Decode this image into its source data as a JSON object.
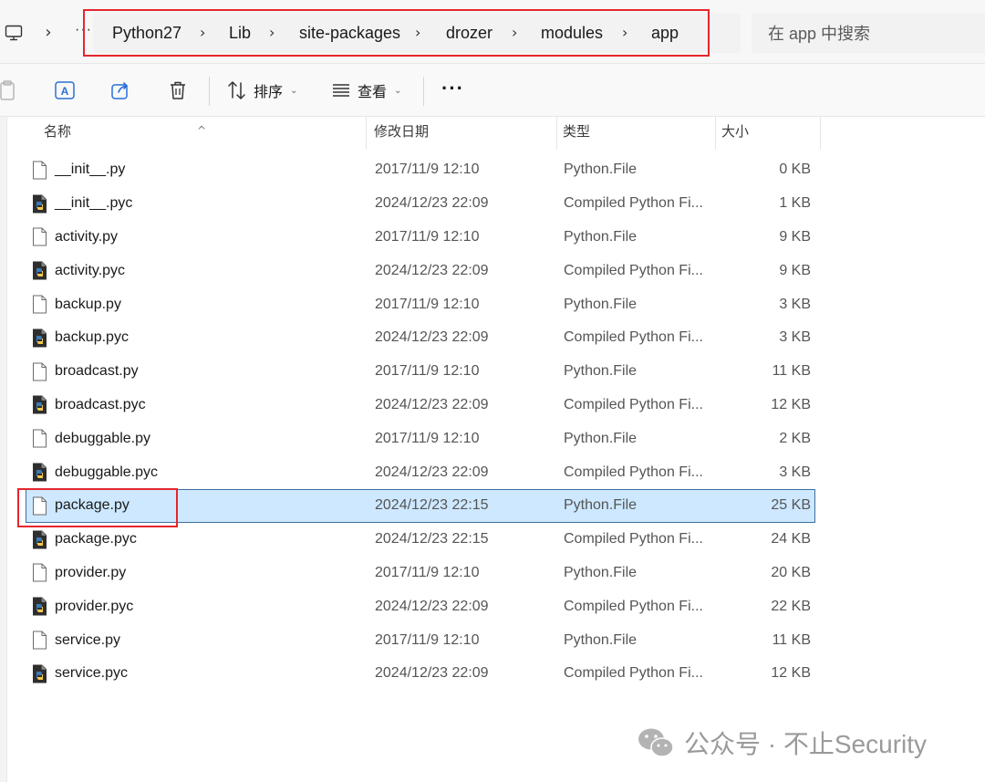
{
  "nav": {
    "more_label": "···",
    "breadcrumbs": [
      "Python27",
      "Lib",
      "site-packages",
      "drozer",
      "modules",
      "app"
    ],
    "search_placeholder": "在 app 中搜索"
  },
  "toolbar": {
    "sort_label": "排序",
    "view_label": "查看",
    "more_label": "···"
  },
  "columns": {
    "name": "名称",
    "date": "修改日期",
    "type": "类型",
    "size": "大小"
  },
  "files": [
    {
      "name": "__init__.py",
      "date": "2017/11/9 12:10",
      "type": "Python.File",
      "size": "0 KB",
      "icon": "py-file-icon"
    },
    {
      "name": "__init__.pyc",
      "date": "2024/12/23 22:09",
      "type": "Compiled Python Fi...",
      "size": "1 KB",
      "icon": "pyc-file-icon"
    },
    {
      "name": "activity.py",
      "date": "2017/11/9 12:10",
      "type": "Python.File",
      "size": "9 KB",
      "icon": "py-file-icon"
    },
    {
      "name": "activity.pyc",
      "date": "2024/12/23 22:09",
      "type": "Compiled Python Fi...",
      "size": "9 KB",
      "icon": "pyc-file-icon"
    },
    {
      "name": "backup.py",
      "date": "2017/11/9 12:10",
      "type": "Python.File",
      "size": "3 KB",
      "icon": "py-file-icon"
    },
    {
      "name": "backup.pyc",
      "date": "2024/12/23 22:09",
      "type": "Compiled Python Fi...",
      "size": "3 KB",
      "icon": "pyc-file-icon"
    },
    {
      "name": "broadcast.py",
      "date": "2017/11/9 12:10",
      "type": "Python.File",
      "size": "11 KB",
      "icon": "py-file-icon"
    },
    {
      "name": "broadcast.pyc",
      "date": "2024/12/23 22:09",
      "type": "Compiled Python Fi...",
      "size": "12 KB",
      "icon": "pyc-file-icon"
    },
    {
      "name": "debuggable.py",
      "date": "2017/11/9 12:10",
      "type": "Python.File",
      "size": "2 KB",
      "icon": "py-file-icon"
    },
    {
      "name": "debuggable.pyc",
      "date": "2024/12/23 22:09",
      "type": "Compiled Python Fi...",
      "size": "3 KB",
      "icon": "pyc-file-icon"
    },
    {
      "name": "package.py",
      "date": "2024/12/23 22:15",
      "type": "Python.File",
      "size": "25 KB",
      "icon": "py-file-icon",
      "selected": true
    },
    {
      "name": "package.pyc",
      "date": "2024/12/23 22:15",
      "type": "Compiled Python Fi...",
      "size": "24 KB",
      "icon": "pyc-file-icon"
    },
    {
      "name": "provider.py",
      "date": "2017/11/9 12:10",
      "type": "Python.File",
      "size": "20 KB",
      "icon": "py-file-icon"
    },
    {
      "name": "provider.pyc",
      "date": "2024/12/23 22:09",
      "type": "Compiled Python Fi...",
      "size": "22 KB",
      "icon": "pyc-file-icon"
    },
    {
      "name": "service.py",
      "date": "2017/11/9 12:10",
      "type": "Python.File",
      "size": "11 KB",
      "icon": "py-file-icon"
    },
    {
      "name": "service.pyc",
      "date": "2024/12/23 22:09",
      "type": "Compiled Python Fi...",
      "size": "12 KB",
      "icon": "pyc-file-icon"
    }
  ],
  "watermark": {
    "text": "公众号 · 不止Security",
    "icon": "wechat-icon"
  },
  "colors": {
    "selection_bg": "#cde8ff",
    "selection_border": "#3d6f9e",
    "highlight_red": "#e6262e"
  }
}
